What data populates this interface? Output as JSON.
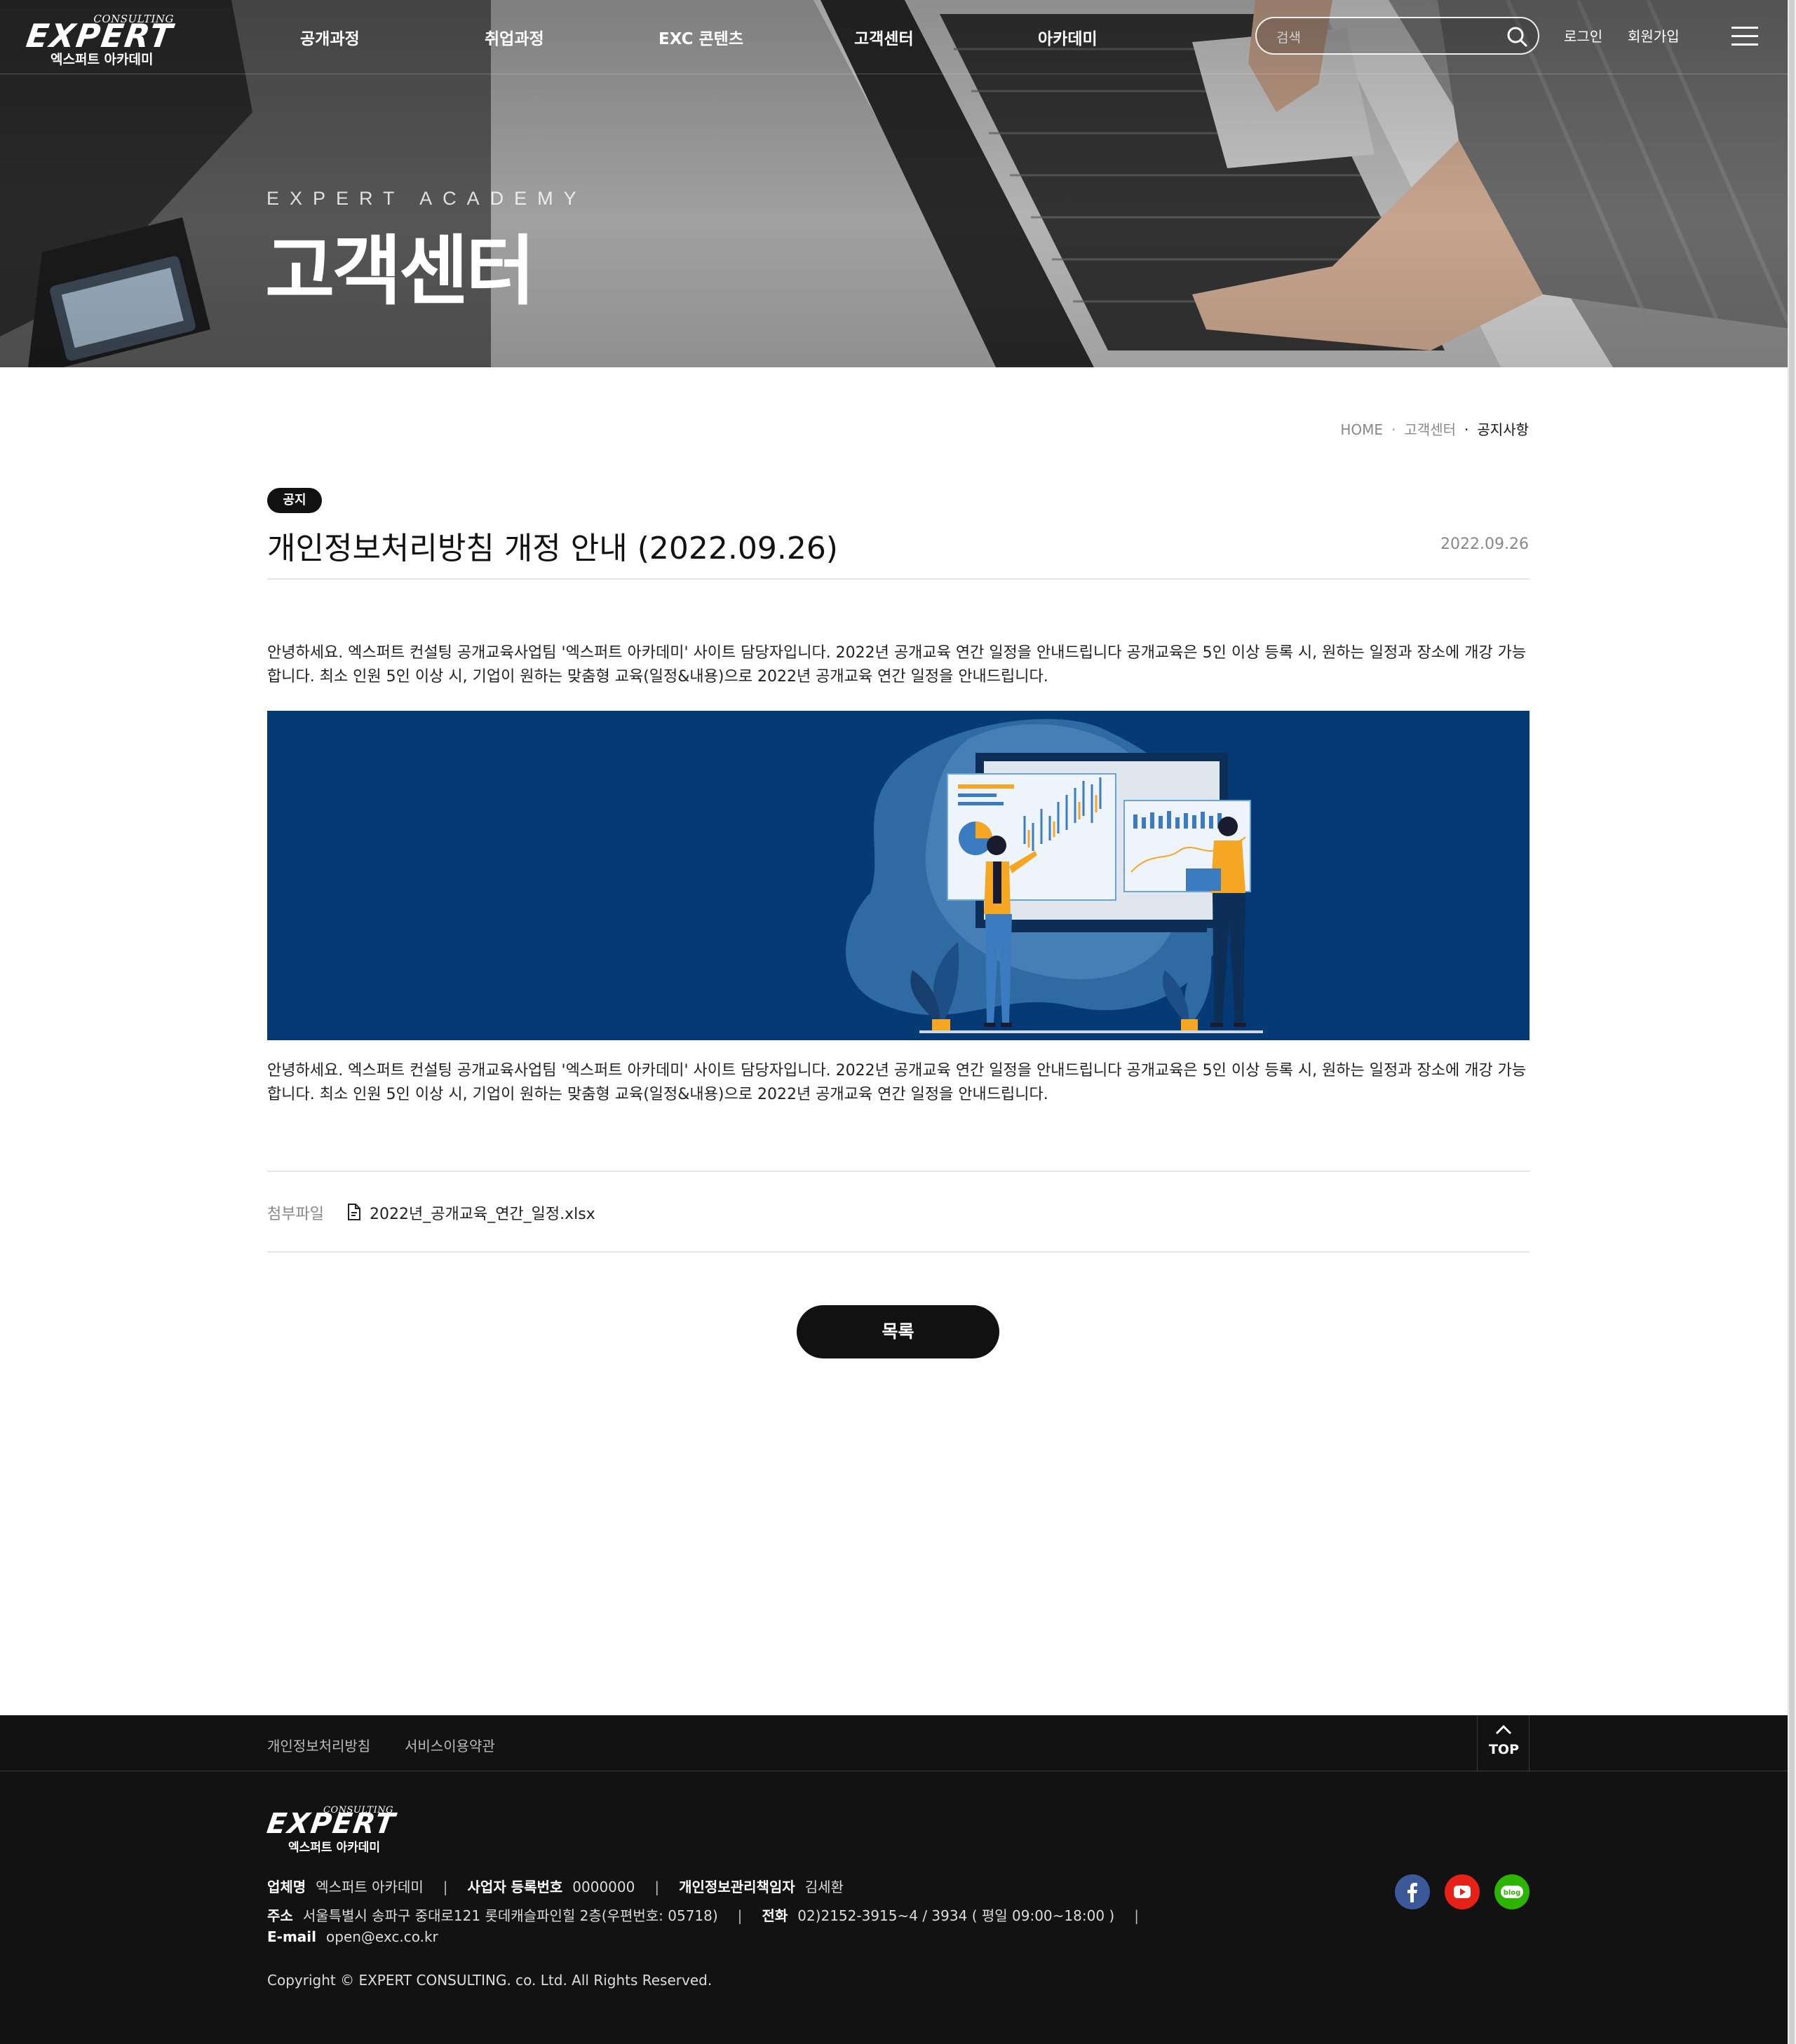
{
  "header": {
    "logo": {
      "top_text": "CONSULTING",
      "word": "EXPERT",
      "sub": "엑스퍼트 아카데미"
    },
    "menu": [
      "공개과정",
      "취업과정",
      "EXC 콘텐츠",
      "고객센터",
      "아카데미"
    ],
    "search": {
      "placeholder": "검색",
      "icon": "search-icon"
    },
    "login_label": "로그인",
    "signup_label": "회원가입",
    "menu_icon": "hamburger-icon"
  },
  "hero": {
    "subtitle": "EXPERT ACADEMY",
    "title": "고객센터"
  },
  "breadcrumb": [
    "HOME",
    "고객센터",
    "공지사항"
  ],
  "post": {
    "badge": "공지",
    "title": "개인정보처리방침 개정 안내 (2022.09.26)",
    "date": "2022.09.26",
    "paragraph_1": "안녕하세요. 엑스퍼트 컨설팅 공개교육사업팀 '엑스퍼트 아카데미' 사이트 담당자입니다. 2022년 공개교육 연간 일정을 안내드립니다 공개교육은 5인 이상 등록 시, 원하는 일정과 장소에 개강 가능합니다. 최소 인원 5인 이상 시, 기업이 원하는 맞춤형 교육(일정&내용)으로 2022년 공개교육 연간 일정을 안내드립니다.",
    "paragraph_2": "안녕하세요. 엑스퍼트 컨설팅 공개교육사업팀 '엑스퍼트 아카데미' 사이트 담당자입니다. 2022년 공개교육 연간 일정을 안내드립니다 공개교육은 5인 이상 등록 시, 원하는 일정과 장소에 개강 가능합니다. 최소 인원 5인 이상 시, 기업이 원하는 맞춤형 교육(일정&내용)으로 2022년 공개교육 연간 일정을 안내드립니다.",
    "attachment_label": "첨부파일",
    "attachment_name": "2022년_공개교육_연간_일정.xlsx",
    "list_button": "목록"
  },
  "footer": {
    "links": [
      "개인정보처리방침",
      "서비스이용약관"
    ],
    "top_label": "TOP",
    "company_label": "업체명",
    "company": "엑스퍼트 아카데미",
    "biz_label": "사업자 등록번호",
    "biz_no": "0000000",
    "privacy_label": "개인정보관리책임자",
    "privacy_officer": "김세환",
    "address_label": "주소",
    "address": "서울특별시 송파구 중대로121 롯데캐슬파인힐 2층(우편번호: 05718)",
    "phone_label": "전화",
    "phone": "02)2152-3915~4 / 3934 ( 평일 09:00~18:00 )",
    "email_label": "E-mail",
    "email": "open@exc.co.kr",
    "copyright": "Copyright © EXPERT CONSULTING. co. Ltd. All Rights Reserved.",
    "social": {
      "facebook": {
        "icon": "facebook-icon",
        "color": "#3b5998"
      },
      "youtube": {
        "icon": "youtube-icon",
        "color": "#e62117"
      },
      "blog": {
        "icon": "blog-icon",
        "color": "#2db400",
        "text": "blog"
      }
    }
  },
  "colors": {
    "banner_bg": "#053a74",
    "footer_bg": "#121212",
    "accent_yellow": "#f5a623"
  }
}
